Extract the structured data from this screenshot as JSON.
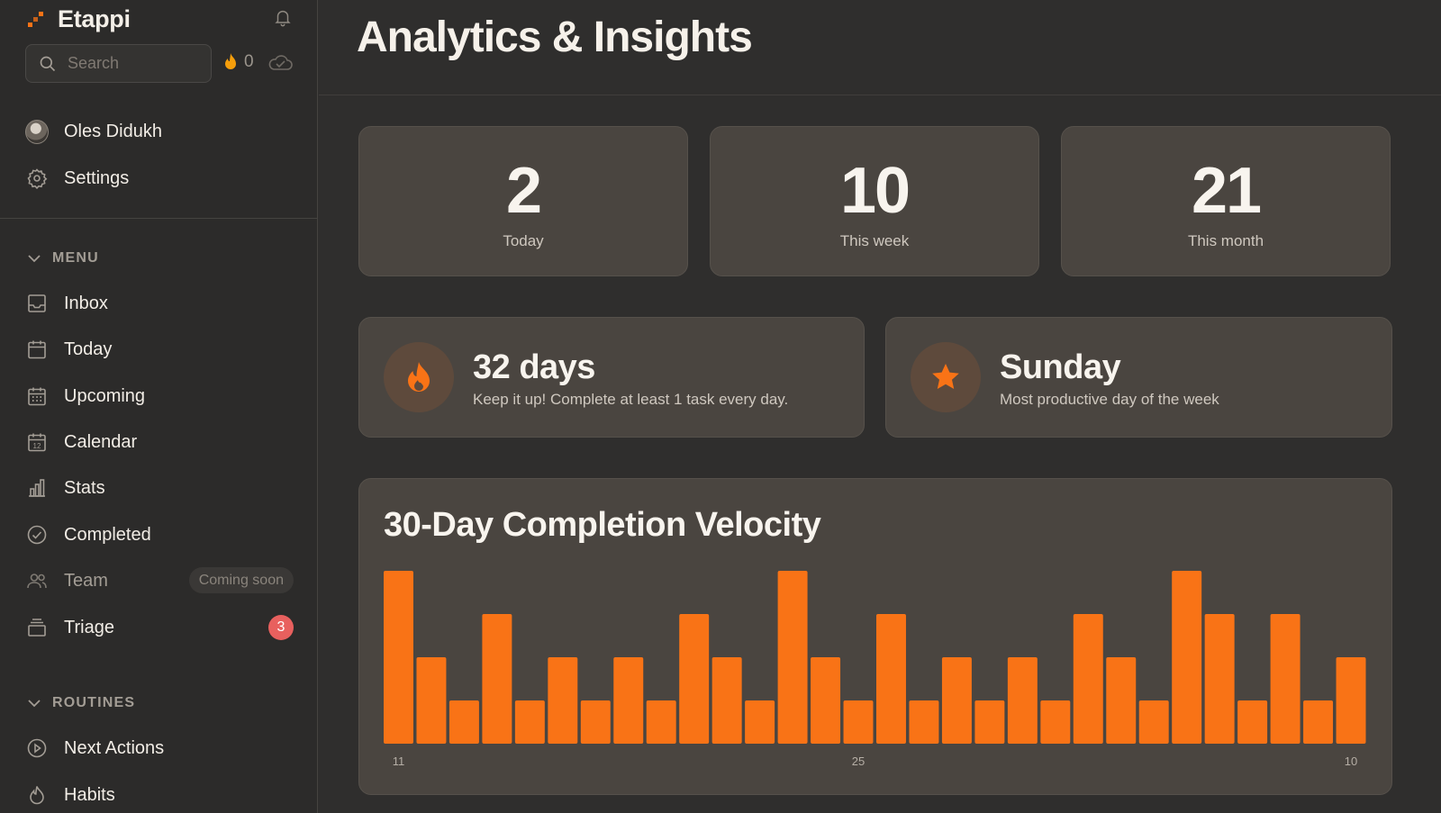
{
  "app": {
    "name": "Etappi",
    "search_placeholder": "Search",
    "streak_count": "0"
  },
  "sidebar": {
    "user_name": "Oles Didukh",
    "settings_label": "Settings",
    "menu_header": "MENU",
    "menu": [
      {
        "label": "Inbox",
        "icon": "inbox-icon"
      },
      {
        "label": "Today",
        "icon": "calendar-today-icon"
      },
      {
        "label": "Upcoming",
        "icon": "calendar-upcoming-icon"
      },
      {
        "label": "Calendar",
        "icon": "calendar-12-icon"
      },
      {
        "label": "Stats",
        "icon": "bar-chart-icon"
      },
      {
        "label": "Completed",
        "icon": "check-circle-icon"
      },
      {
        "label": "Team",
        "icon": "team-icon",
        "pill": "Coming soon"
      },
      {
        "label": "Triage",
        "icon": "triage-icon",
        "badge": "3"
      }
    ],
    "routines_header": "ROUTINES",
    "routines": [
      {
        "label": "Next Actions",
        "icon": "play-circle-icon"
      },
      {
        "label": "Habits",
        "icon": "flame-icon"
      }
    ]
  },
  "main": {
    "title": "Analytics & Insights",
    "stats": [
      {
        "value": "2",
        "caption": "Today"
      },
      {
        "value": "10",
        "caption": "This week"
      },
      {
        "value": "21",
        "caption": "This month"
      }
    ],
    "streak": {
      "title": "32 days",
      "subtitle": "Keep it up! Complete at least 1 task every day.",
      "icon": "flame-icon"
    },
    "productive_day": {
      "title": "Sunday",
      "subtitle": "Most productive day of the week",
      "icon": "star-icon"
    }
  },
  "colors": {
    "accent": "#f97316",
    "badge": "#e8605e"
  },
  "chart_data": {
    "type": "bar",
    "title": "30-Day Completion Velocity",
    "tick_labels": [
      {
        "index": 0,
        "label": "11"
      },
      {
        "index": 14,
        "label": "25"
      },
      {
        "index": 29,
        "label": "10"
      }
    ],
    "values": [
      4,
      2,
      1,
      3,
      1,
      2,
      1,
      2,
      1,
      3,
      2,
      1,
      4,
      2,
      1,
      3,
      1,
      2,
      1,
      2,
      1,
      3,
      2,
      1,
      4,
      3,
      1,
      3,
      1,
      2
    ],
    "ylim": [
      0,
      4
    ],
    "color": "#f97316",
    "grid": false
  }
}
